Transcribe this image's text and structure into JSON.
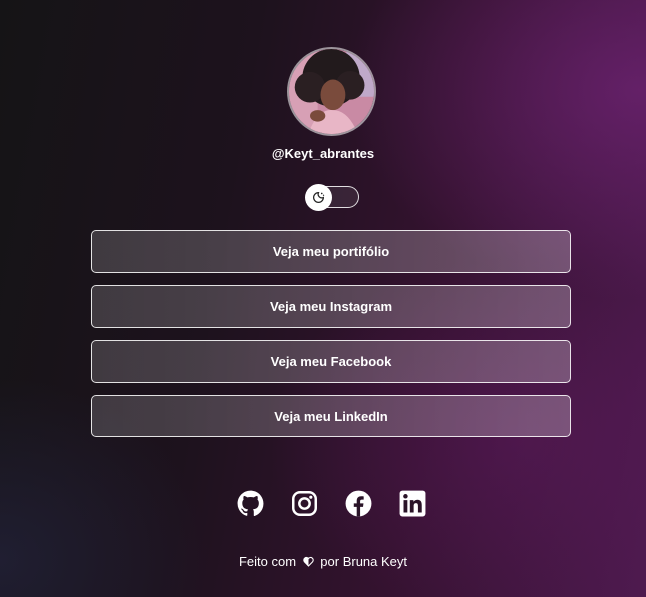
{
  "profile": {
    "username": "@Keyt_abrantes",
    "avatar_icon": "profile-photo"
  },
  "theme_toggle": {
    "icon": "moon-sun-icon",
    "state": "off"
  },
  "links": [
    {
      "label": "Veja meu portifólio"
    },
    {
      "label": "Veja meu Instagram"
    },
    {
      "label": "Veja meu Facebook"
    },
    {
      "label": "Veja meu LinkedIn"
    }
  ],
  "socials": [
    {
      "icon": "github-icon"
    },
    {
      "icon": "instagram-icon"
    },
    {
      "icon": "facebook-icon"
    },
    {
      "icon": "linkedin-icon"
    }
  ],
  "footer": {
    "prefix": "Feito com",
    "heart_icon": "heart-icon",
    "suffix": "por Bruna Keyt"
  },
  "colors": {
    "text": "#ffffff",
    "accent_purple": "#5a1a5c"
  }
}
